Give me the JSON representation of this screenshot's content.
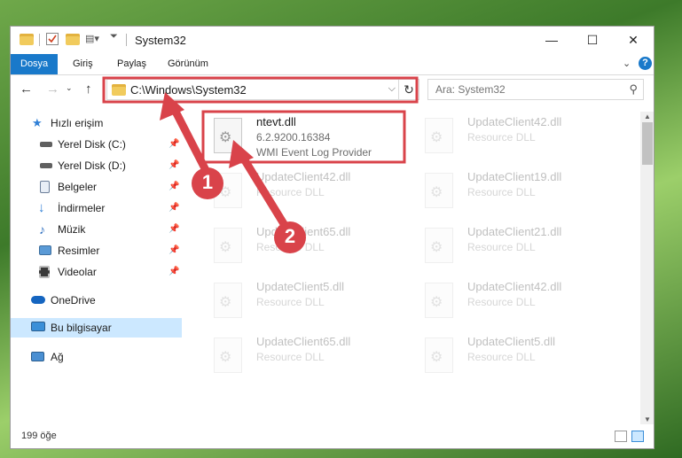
{
  "window": {
    "title": "System32",
    "buttons": {
      "minimize": "—",
      "maximize": "☐",
      "close": "✕"
    }
  },
  "ribbon": {
    "tabs": [
      "Dosya",
      "Giriş",
      "Paylaş",
      "Görünüm"
    ],
    "collapse_icon": "chevron-down-icon",
    "help": "?"
  },
  "navigation": {
    "back": "←",
    "forward": "→",
    "up": "↑",
    "address": "C:\\Windows\\System32",
    "dropdown": "⌵",
    "refresh": "↻",
    "search_placeholder": "Ara: System32",
    "search_icon": "⚲"
  },
  "sidebar": {
    "items": [
      {
        "label": "Hızlı erişim",
        "icon": "star-icon",
        "pinned": false
      },
      {
        "label": "Yerel Disk (C:)",
        "icon": "drive-icon",
        "pinned": true
      },
      {
        "label": "Yerel Disk (D:)",
        "icon": "drive-icon",
        "pinned": true
      },
      {
        "label": "Belgeler",
        "icon": "documents-icon",
        "pinned": true
      },
      {
        "label": "İndirmeler",
        "icon": "download-icon",
        "pinned": true
      },
      {
        "label": "Müzik",
        "icon": "music-icon",
        "pinned": true
      },
      {
        "label": "Resimler",
        "icon": "pictures-icon",
        "pinned": true
      },
      {
        "label": "Videolar",
        "icon": "videos-icon",
        "pinned": true
      },
      {
        "label": "OneDrive",
        "icon": "cloud-icon",
        "pinned": false
      },
      {
        "label": "Bu bilgisayar",
        "icon": "computer-icon",
        "pinned": false,
        "selected": true
      },
      {
        "label": "Ağ",
        "icon": "network-icon",
        "pinned": false
      }
    ],
    "pin_glyph": "📌"
  },
  "files": {
    "highlighted": {
      "name": "ntevt.dll",
      "version": "6.2.9200.16384",
      "description": "WMI Event Log Provider"
    },
    "faded": [
      {
        "name": "UpdateClient42.dll",
        "description": "Resource DLL"
      },
      {
        "name": "UpdateClient42.dll",
        "description": "Resource DLL"
      },
      {
        "name": "UpdateClient19.dll",
        "description": "Resource DLL"
      },
      {
        "name": "UpdateClient65.dll",
        "description": "Resource DLL"
      },
      {
        "name": "UpdateClient21.dll",
        "description": "Resource DLL"
      },
      {
        "name": "UpdateClient5.dll",
        "description": "Resource DLL"
      },
      {
        "name": "UpdateClient42.dll",
        "description": "Resource DLL"
      },
      {
        "name": "UpdateClient65.dll",
        "description": "Resource DLL"
      },
      {
        "name": "UpdateClient5.dll",
        "description": "Resource DLL"
      }
    ]
  },
  "status": {
    "item_count": "199 öğe"
  },
  "annotations": {
    "step1": "1",
    "step2": "2",
    "color": "#d9434a"
  }
}
